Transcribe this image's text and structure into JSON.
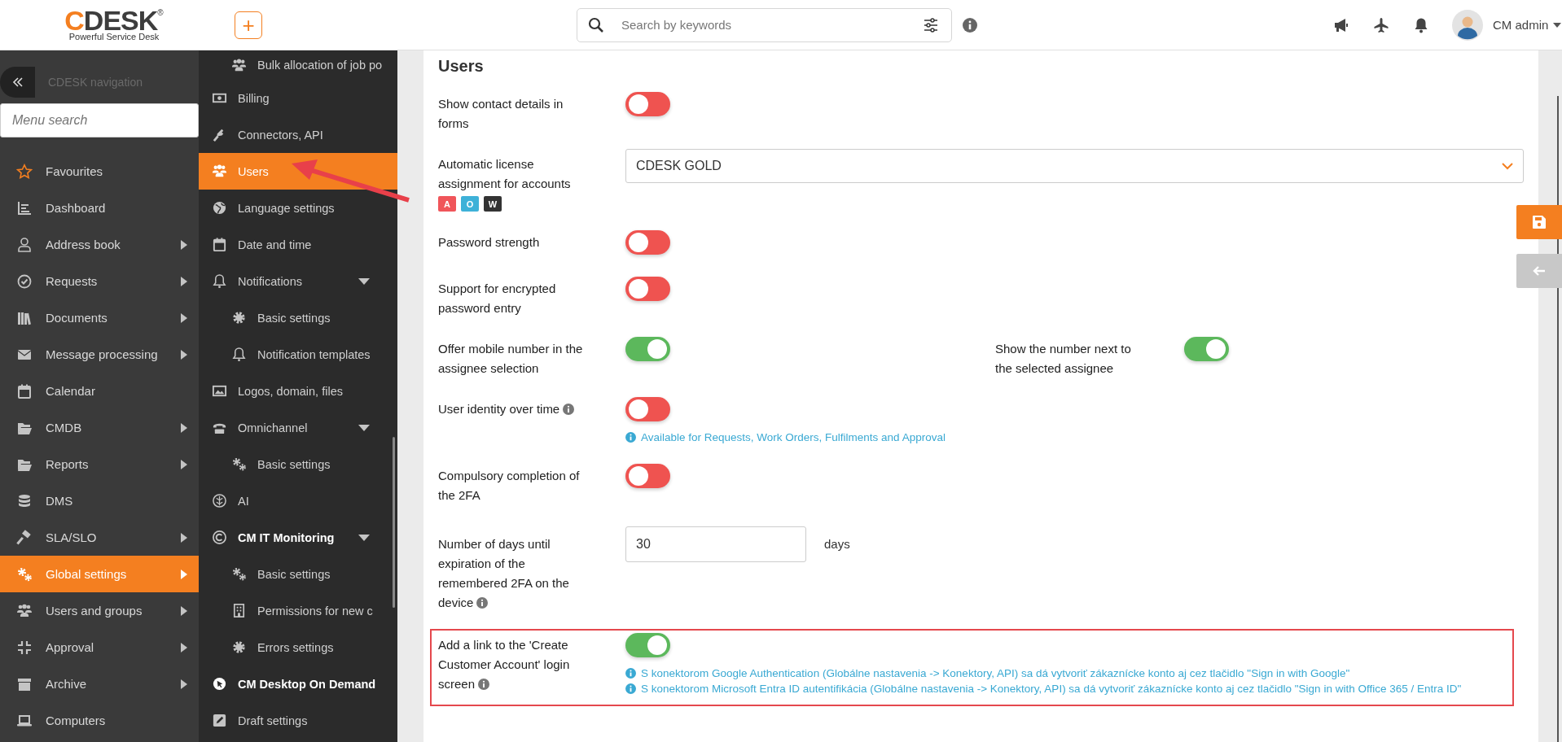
{
  "header": {
    "logo": {
      "mark": "C",
      "name": "DESK",
      "registered": "®",
      "tagline": "Powerful Service Desk"
    },
    "add_button": "+",
    "search": {
      "placeholder": "Search by keywords"
    },
    "user": {
      "name": "CM admin"
    }
  },
  "nav": {
    "title": "CDESK navigation",
    "search": {
      "placeholder": "Menu search"
    },
    "items": [
      {
        "label": "Favourites",
        "submenu": false,
        "selected": false
      },
      {
        "label": "Dashboard",
        "submenu": false,
        "selected": false
      },
      {
        "label": "Address book",
        "submenu": true,
        "selected": false
      },
      {
        "label": "Requests",
        "submenu": true,
        "selected": false
      },
      {
        "label": "Documents",
        "submenu": true,
        "selected": false
      },
      {
        "label": "Message processing",
        "submenu": true,
        "selected": false
      },
      {
        "label": "Calendar",
        "submenu": false,
        "selected": false
      },
      {
        "label": "CMDB",
        "submenu": true,
        "selected": false
      },
      {
        "label": "Reports",
        "submenu": true,
        "selected": false
      },
      {
        "label": "DMS",
        "submenu": false,
        "selected": false
      },
      {
        "label": "SLA/SLO",
        "submenu": true,
        "selected": false
      },
      {
        "label": "Global settings",
        "submenu": true,
        "selected": true
      },
      {
        "label": "Users and groups",
        "submenu": true,
        "selected": false
      },
      {
        "label": "Approval",
        "submenu": true,
        "selected": false
      },
      {
        "label": "Archive",
        "submenu": true,
        "selected": false
      },
      {
        "label": "Computers",
        "submenu": false,
        "selected": false
      }
    ]
  },
  "submenu": {
    "items": [
      {
        "children": [
          {
            "label": "Bulk allocation of job po"
          }
        ]
      },
      {
        "label": "Billing",
        "selected": false,
        "emphasized": false,
        "annotated": false
      },
      {
        "label": "Connectors, API",
        "selected": false,
        "emphasized": false,
        "annotated": false
      },
      {
        "label": "Users",
        "selected": true,
        "emphasized": false,
        "annotated": true
      },
      {
        "label": "Language settings",
        "selected": false,
        "emphasized": false,
        "annotated": false
      },
      {
        "label": "Date and time",
        "selected": false,
        "emphasized": false,
        "annotated": false
      },
      {
        "label": "Notifications",
        "selected": false,
        "emphasized": false,
        "annotated": false,
        "expanded": true,
        "children": [
          {
            "label": "Basic settings"
          },
          {
            "label": "Notification templates"
          }
        ]
      },
      {
        "label": "Logos, domain, files",
        "selected": false,
        "emphasized": false,
        "annotated": false
      },
      {
        "label": "Omnichannel",
        "selected": false,
        "emphasized": false,
        "annotated": false,
        "expanded": true,
        "children": [
          {
            "label": "Basic settings"
          }
        ]
      },
      {
        "label": "AI",
        "selected": false,
        "emphasized": false,
        "annotated": false
      },
      {
        "label": "CM IT Monitoring",
        "selected": false,
        "emphasized": true,
        "annotated": false,
        "expanded": true,
        "children": [
          {
            "label": "Basic settings"
          },
          {
            "label": "Permissions for new c"
          },
          {
            "label": "Errors settings"
          }
        ]
      },
      {
        "label": "CM Desktop On Demand",
        "selected": false,
        "emphasized": true,
        "annotated": false
      },
      {
        "label": "Draft settings",
        "selected": false,
        "emphasized": false,
        "annotated": false
      }
    ]
  },
  "page": {
    "title": "Users",
    "settings": [
      {
        "kind": "toggle",
        "label": "Show contact details in forms",
        "on": false,
        "highlighted": false
      },
      {
        "kind": "select",
        "label": "Automatic license assignment for accounts",
        "tags": [
          {
            "text": "A",
            "color": "#f0555a"
          },
          {
            "text": "O",
            "color": "#3eb1d8"
          },
          {
            "text": "W",
            "color": "#333333"
          }
        ],
        "value": "CDESK GOLD",
        "highlighted": false
      },
      {
        "kind": "toggle",
        "label": "Password strength",
        "on": false,
        "highlighted": false
      },
      {
        "kind": "toggle",
        "label": "Support for encrypted password entry",
        "on": false,
        "highlighted": false
      },
      {
        "kind": "toggle",
        "label": "Offer mobile number in the assignee selection",
        "on": true,
        "highlighted": false,
        "paired": {
          "label": "Show the number next to the selected assignee",
          "on": true
        }
      },
      {
        "kind": "toggle",
        "label": "User identity over time",
        "info": true,
        "on": false,
        "highlighted": false,
        "notes": [
          "Available for Requests, Work Orders, Fulfilments and Approval"
        ]
      },
      {
        "kind": "toggle",
        "label": "Compulsory completion of the 2FA",
        "on": false,
        "highlighted": false
      },
      {
        "kind": "number",
        "label": "Number of days until expiration of the remembered 2FA on the device",
        "info": true,
        "value": "30",
        "unit": "days",
        "highlighted": false
      },
      {
        "kind": "toggle",
        "label": "Add a link to the 'Create Customer Account' login screen",
        "info": true,
        "on": true,
        "highlighted": true,
        "notes": [
          "S konektorom Google Authentication (Globálne nastavenia -> Konektory, API) sa dá vytvoriť zákaznícke konto aj cez tlačidlo \"Sign in with Google\"",
          "S konektorom Microsoft Entra ID autentifikácia (Globálne nastavenia -> Konektory, API) sa dá vytvoriť zákaznícke konto aj cez tlačidlo \"Sign in with Office 365 / Entra ID\""
        ]
      }
    ]
  }
}
